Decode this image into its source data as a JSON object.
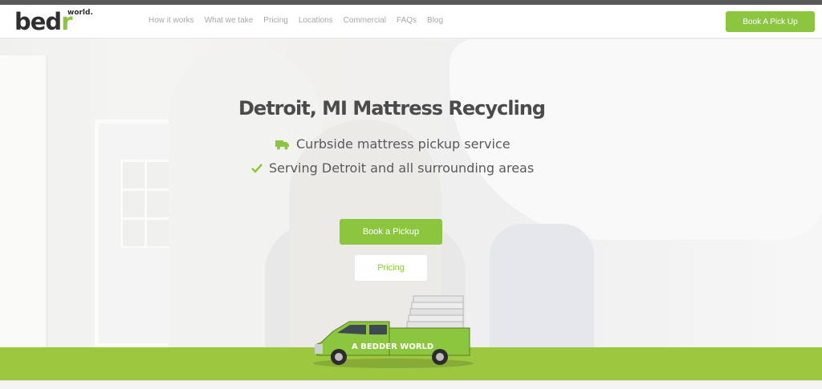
{
  "header": {
    "logo": {
      "main": "bedr",
      "superscript": "world."
    },
    "nav": [
      {
        "label": "How it works"
      },
      {
        "label": "What we take"
      },
      {
        "label": "Pricing"
      },
      {
        "label": "Locations"
      },
      {
        "label": "Commercial"
      },
      {
        "label": "FAQs"
      },
      {
        "label": "Blog"
      }
    ],
    "cta_label": "Book A Pick Up"
  },
  "hero": {
    "title": "Detroit, MI Mattress Recycling",
    "features": [
      {
        "icon": "truck-icon",
        "text": "Curbside mattress pickup service"
      },
      {
        "icon": "check-icon",
        "text": "Serving Detroit and all surrounding areas"
      }
    ],
    "primary_button": "Book a Pickup",
    "secondary_button": "Pricing"
  },
  "truck": {
    "text": "A BEDDER WORLD"
  },
  "colors": {
    "accent": "#8cc63f",
    "band": "#9cc73f",
    "title": "#4b4b4b",
    "nav_text": "#a7a7a7"
  }
}
